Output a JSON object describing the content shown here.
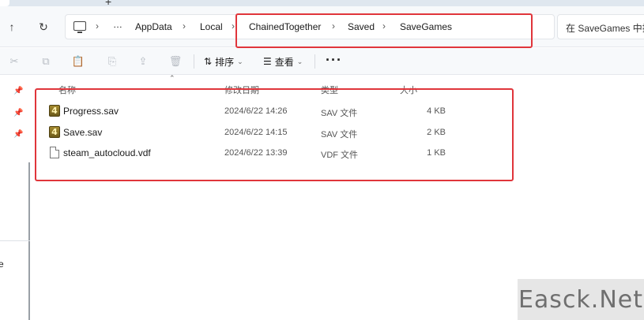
{
  "window": {
    "new_tab_label": "+"
  },
  "nav": {
    "back_icon": "arrow-up-icon",
    "refresh_icon": "refresh-icon",
    "breadcrumb": [
      "…",
      "AppData",
      "Local",
      "ChainedTogether",
      "Saved",
      "SaveGames"
    ],
    "separator": "›",
    "search_placeholder": "在 SaveGames 中搜"
  },
  "toolbar": {
    "sort_label": "排序",
    "view_label": "查看",
    "more_label": "···"
  },
  "columns": {
    "name": "名称",
    "modified": "修改日期",
    "type": "类型",
    "size": "大小"
  },
  "files": [
    {
      "name": "Progress.sav",
      "modified": "2024/6/22 14:26",
      "type": "SAV 文件",
      "size": "4 KB",
      "icon": "game-save-icon"
    },
    {
      "name": "Save.sav",
      "modified": "2024/6/22 14:15",
      "type": "SAV 文件",
      "size": "2 KB",
      "icon": "game-save-icon"
    },
    {
      "name": "steam_autocloud.vdf",
      "modified": "2024/6/22 13:39",
      "type": "VDF 文件",
      "size": "1 KB",
      "icon": "document-icon"
    }
  ],
  "sidebar": {
    "partial_label": "e"
  },
  "watermark": "Easck.Net",
  "colors": {
    "highlight_box": "#e0353b",
    "navbar_bg": "#f7f9fb"
  }
}
